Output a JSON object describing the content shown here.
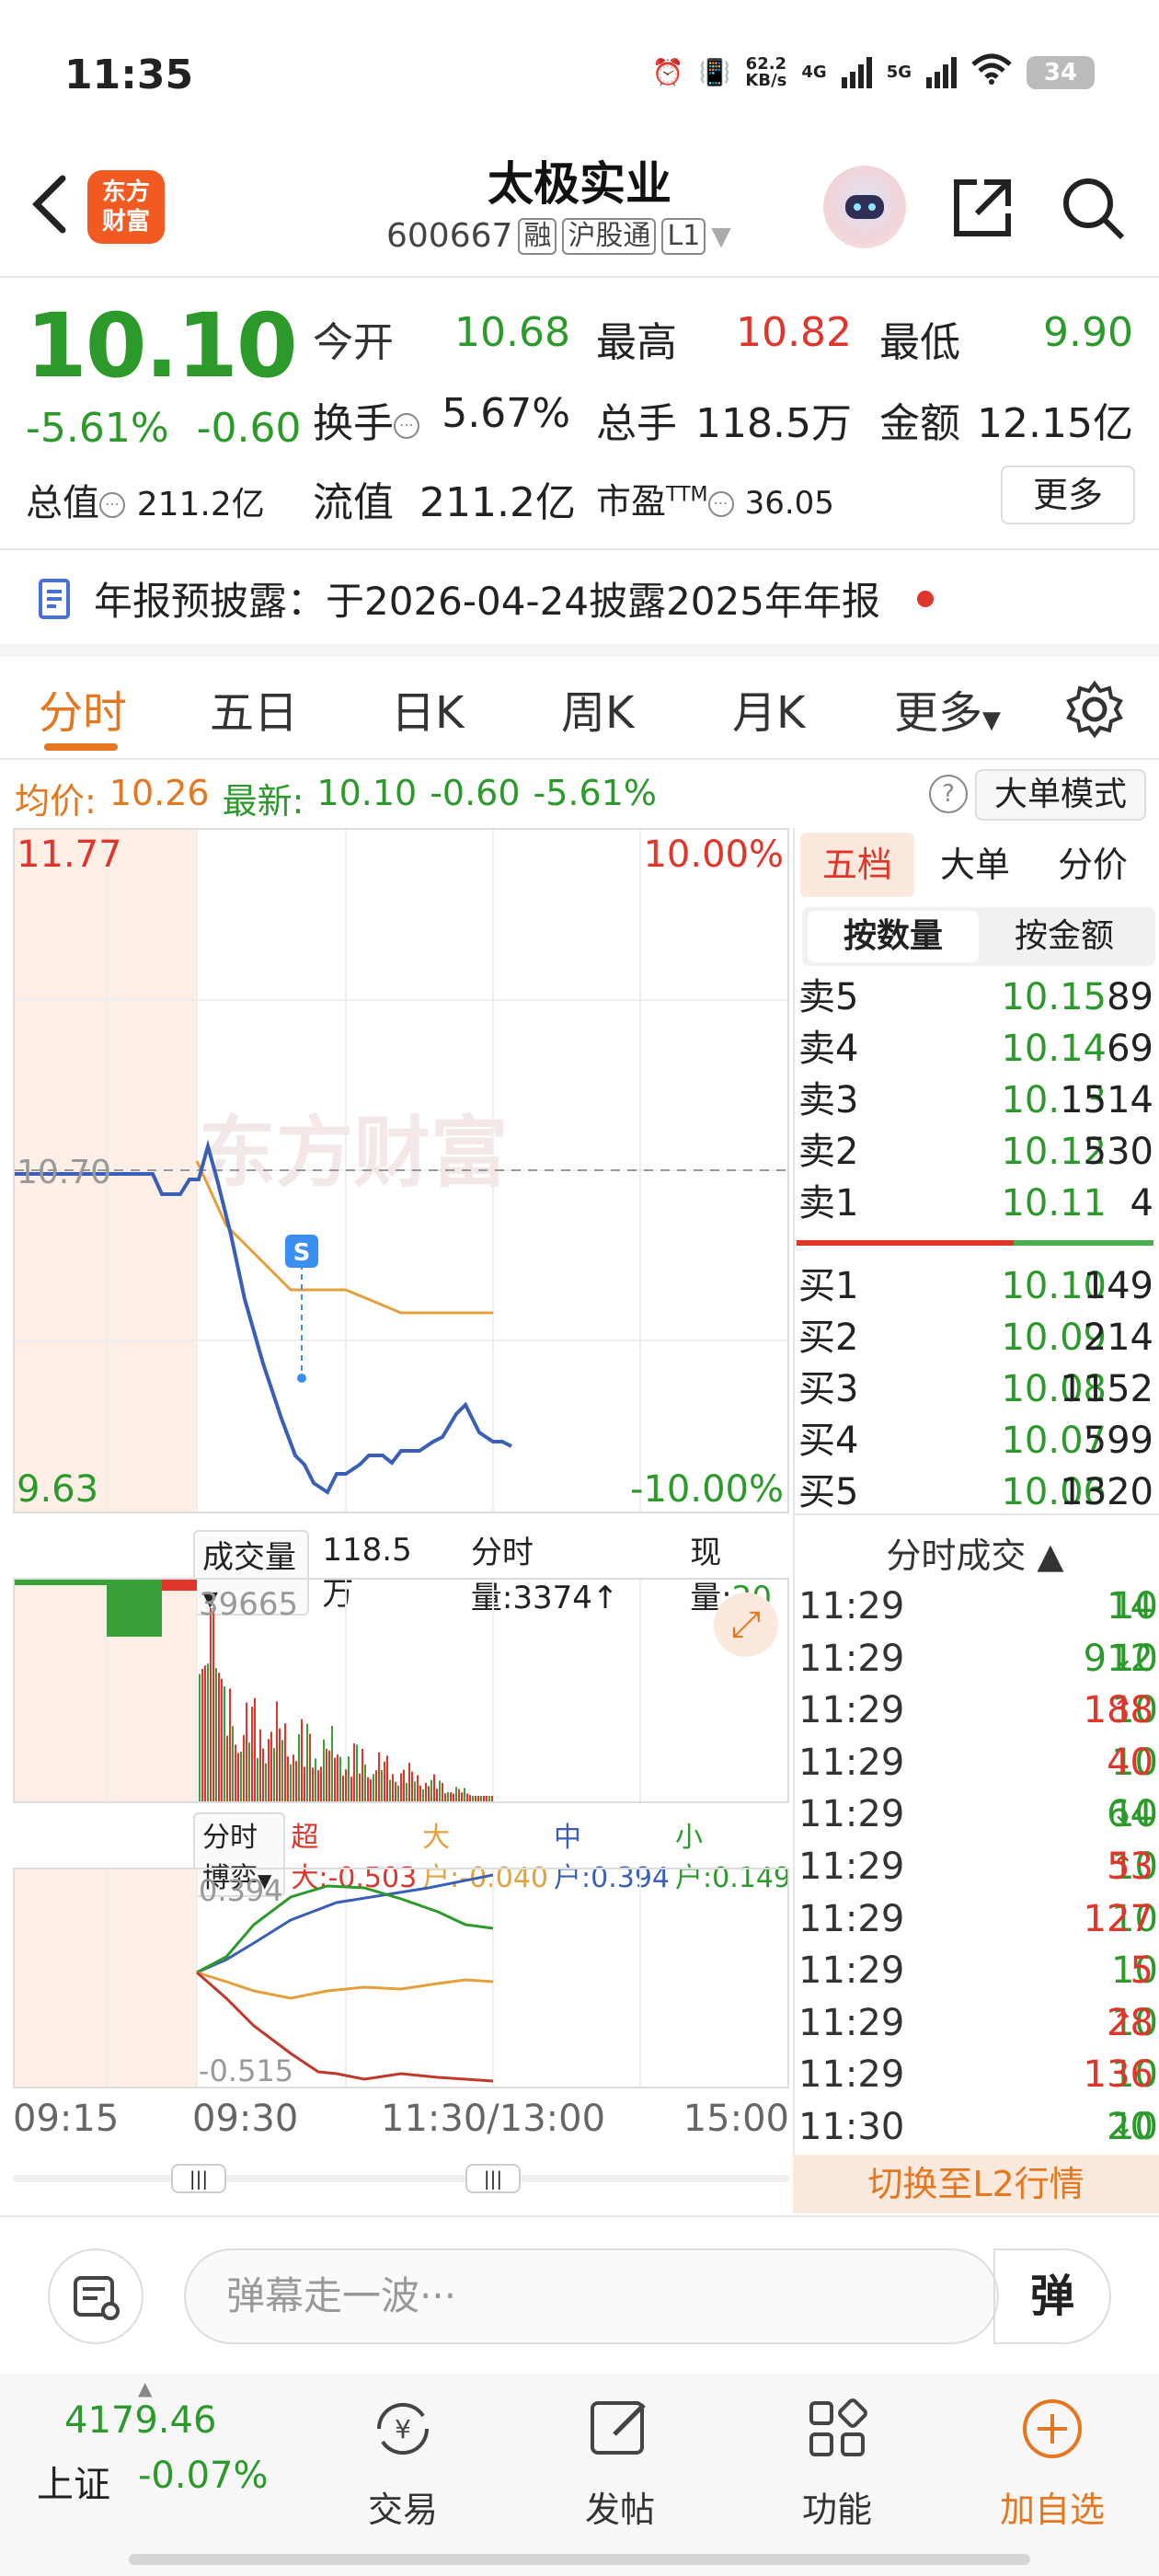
{
  "status": {
    "time": "11:35",
    "net_speed_top": "62.2",
    "net_speed_unit": "KB/s",
    "net1": "4G",
    "net2": "5G",
    "battery": "34"
  },
  "header": {
    "name": "太极实业",
    "code": "600667",
    "tags": [
      "融",
      "沪股通",
      "L1"
    ],
    "logo_line1": "东方",
    "logo_line2": "财富"
  },
  "quote": {
    "price": "10.10",
    "chg_pct": "-5.61%",
    "chg": "-0.60",
    "open_label": "今开",
    "open": "10.68",
    "high_label": "最高",
    "high": "10.82",
    "low_label": "最低",
    "low": "9.90",
    "turnover_label": "换手",
    "turnover": "5.67%",
    "volume_label": "总手",
    "volume": "118.5万",
    "amount_label": "金额",
    "amount": "12.15亿",
    "mktcap_label": "总值",
    "mktcap": "211.2亿",
    "float_label": "流值",
    "float": "211.2亿",
    "pe_label": "市盈",
    "pe_sup": "TTM",
    "pe": "36.05",
    "more": "更多"
  },
  "disclosure": {
    "text": "年报预披露：于2026-04-24披露2025年年报"
  },
  "tabs": [
    "分时",
    "五日",
    "日K",
    "周K",
    "月K",
    "更多"
  ],
  "avg_bar": {
    "avg_label": "均价:",
    "avg": "10.26",
    "latest_label": "最新:",
    "latest": "10.10",
    "chg": "-0.60",
    "pct": "-5.61%",
    "big_order": "大单模式",
    "help": "?"
  },
  "chart": {
    "ymax": "11.77",
    "ymin": "9.63",
    "pct_max": "10.00%",
    "pct_min": "-10.00%",
    "prev_close": "10.70",
    "watermark": "东方财富",
    "signal": "S"
  },
  "volume": {
    "dropdown": "成交量",
    "total": "118.5万",
    "minute": "分时量:3374↑",
    "now_label": "现量:",
    "now": "20",
    "peak": "39665"
  },
  "flow": {
    "dropdown": "分时博弈",
    "super_label": "超大:",
    "super": "-0.503",
    "large_label": "大户:",
    "large": "-0.040",
    "mid_label": "中户:",
    "mid": "0.394",
    "small_label": "小户:",
    "small": "0.149",
    "top": "0.394",
    "bottom": "-0.515"
  },
  "time_axis": [
    "09:15",
    "09:30",
    "11:30/13:00",
    "15:00"
  ],
  "orderbook": {
    "tabs": [
      "五档",
      "大单",
      "分价"
    ],
    "modes": [
      "按数量",
      "按金额"
    ],
    "asks": [
      {
        "label": "卖5",
        "price": "10.15",
        "vol": "89"
      },
      {
        "label": "卖4",
        "price": "10.14",
        "vol": "69"
      },
      {
        "label": "卖3",
        "price": "10.13",
        "vol": "1514"
      },
      {
        "label": "卖2",
        "price": "10.12",
        "vol": "530"
      },
      {
        "label": "卖1",
        "price": "10.11",
        "vol": "4"
      }
    ],
    "bids": [
      {
        "label": "买1",
        "price": "10.10",
        "vol": "149"
      },
      {
        "label": "买2",
        "price": "10.09",
        "vol": "214"
      },
      {
        "label": "买3",
        "price": "10.08",
        "vol": "1152"
      },
      {
        "label": "买4",
        "price": "10.07",
        "vol": "599"
      },
      {
        "label": "买5",
        "price": "10.06",
        "vol": "1320"
      }
    ]
  },
  "trades": {
    "header": "分时成交 ▲",
    "rows": [
      {
        "time": "11:29",
        "price": "10.10",
        "arrow": "",
        "vol": "14",
        "pc": "#2b9a2b",
        "vc": "#2b9a2b"
      },
      {
        "time": "11:29",
        "price": "10.09",
        "arrow": "↓",
        "vol": "912",
        "pc": "#2b9a2b",
        "vc": "#2b9a2b"
      },
      {
        "time": "11:29",
        "price": "10.11",
        "arrow": "↑",
        "vol": "188",
        "pc": "#2b9a2b",
        "vc": "#e0352b"
      },
      {
        "time": "11:29",
        "price": "10.11",
        "arrow": "",
        "vol": "40",
        "pc": "#2b9a2b",
        "vc": "#e0352b"
      },
      {
        "time": "11:29",
        "price": "10.09",
        "arrow": "↓",
        "vol": "64",
        "pc": "#2b9a2b",
        "vc": "#2b9a2b"
      },
      {
        "time": "11:29",
        "price": "10.10",
        "arrow": "↑",
        "vol": "53",
        "pc": "#2b9a2b",
        "vc": "#e0352b"
      },
      {
        "time": "11:29",
        "price": "10.10",
        "arrow": "",
        "vol": "127",
        "pc": "#2b9a2b",
        "vc": "#e0352b"
      },
      {
        "time": "11:29",
        "price": "10.10",
        "arrow": "",
        "vol": "5",
        "pc": "#2b9a2b",
        "vc": "#e0352b"
      },
      {
        "time": "11:29",
        "price": "10.11",
        "arrow": "↑",
        "vol": "28",
        "pc": "#2b9a2b",
        "vc": "#e0352b"
      },
      {
        "time": "11:29",
        "price": "10.11",
        "arrow": "",
        "vol": "136",
        "pc": "#2b9a2b",
        "vc": "#e0352b"
      },
      {
        "time": "11:30",
        "price": "10.10",
        "arrow": "↓",
        "vol": "20",
        "pc": "#2b9a2b",
        "vc": "#2b9a2b"
      }
    ],
    "switch_l2": "切换至L2行情"
  },
  "comment": {
    "placeholder": "弹幕走一波···",
    "danmu": "弹"
  },
  "bottom_nav": {
    "index_value": "4179.46",
    "index_name": "上证",
    "index_chg": "-0.07%",
    "items": [
      "交易",
      "发帖",
      "功能",
      "加自选"
    ]
  },
  "colors": {
    "up": "#e0352b",
    "down": "#2b9a2b",
    "accent": "#e4771f"
  }
}
